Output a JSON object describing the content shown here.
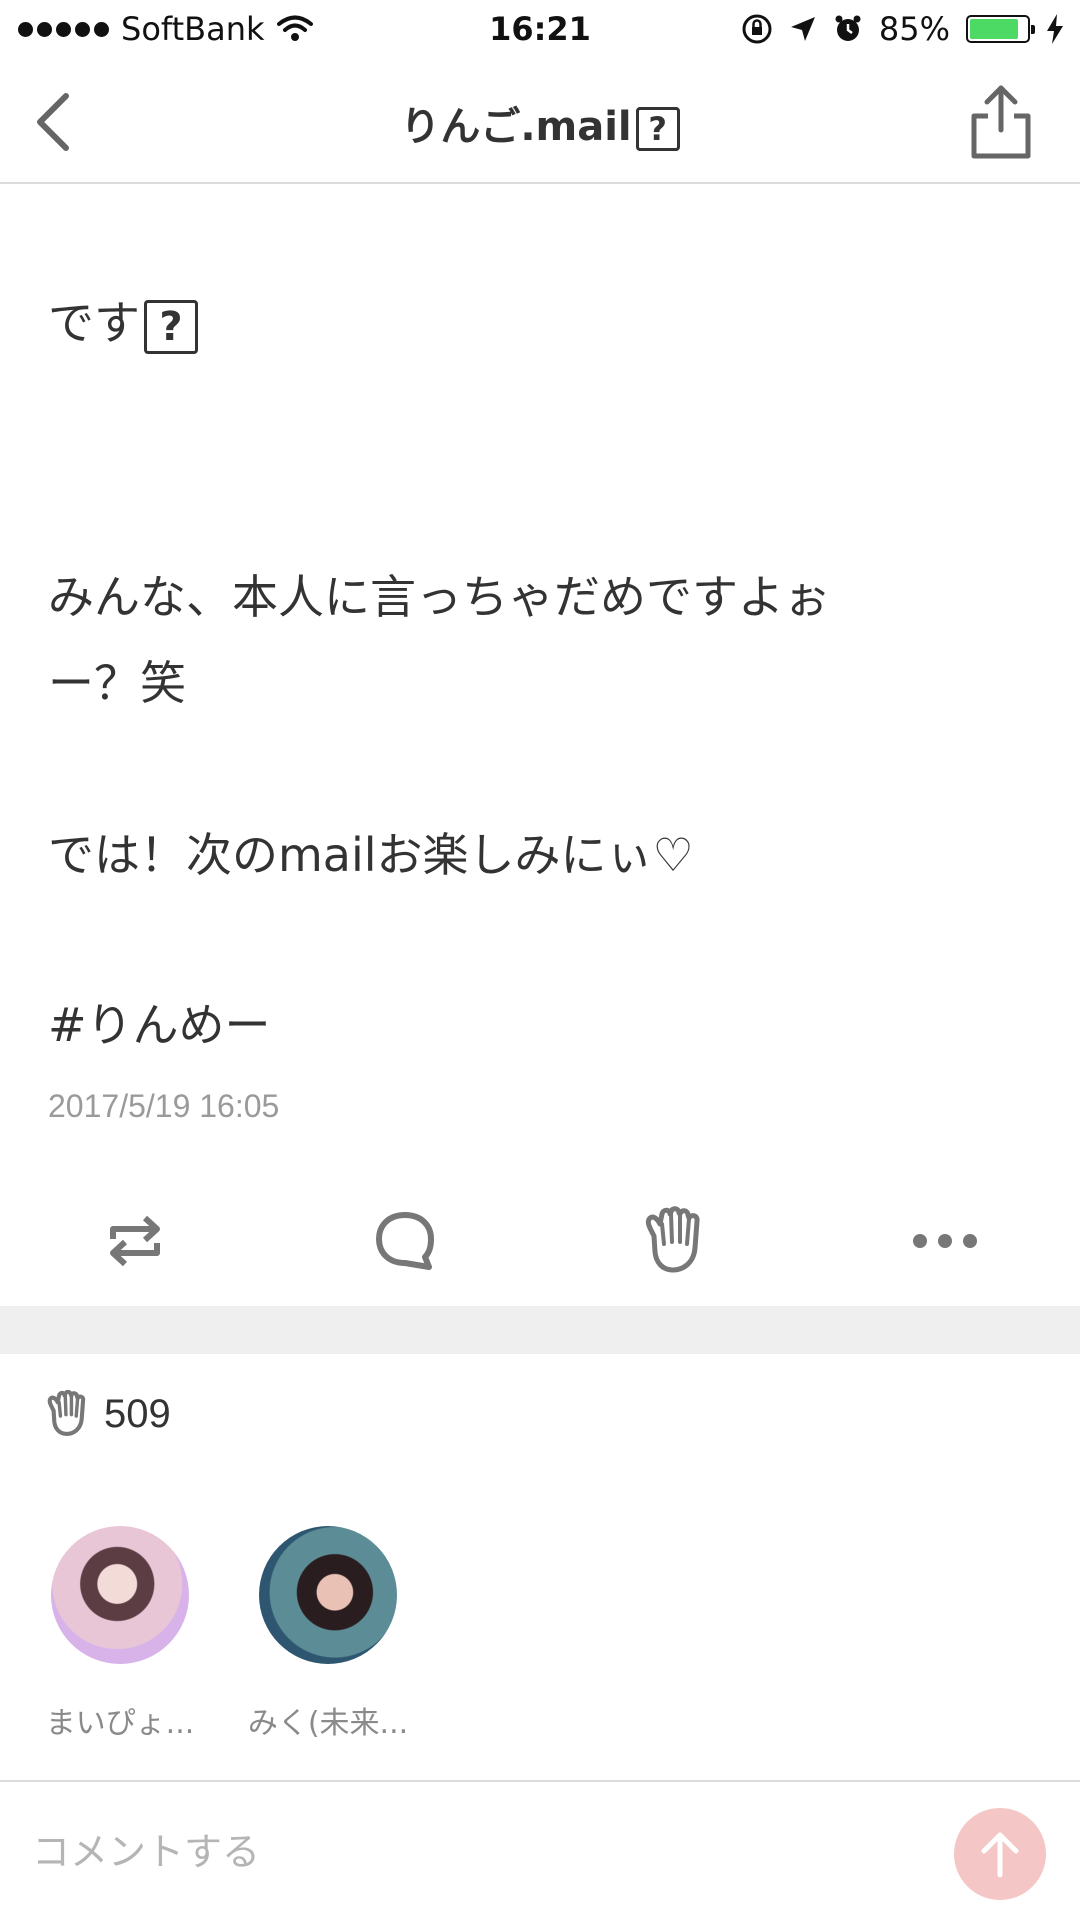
{
  "status_bar": {
    "carrier": "SoftBank",
    "time": "16:21",
    "battery_percent": "85%",
    "battery_level": 0.85
  },
  "nav": {
    "title": "りんご.mail",
    "title_unknown_glyph": "?"
  },
  "post": {
    "line_1": "です",
    "line_1_unknown_glyph": "?",
    "line_2": "みんな、本人に言っちゃだめですよぉ",
    "line_3": "ー？笑",
    "line_4": "では！次のmailお楽しみにぃ♡",
    "hashtag": "#りんめー",
    "timestamp": "2017/5/19 16:05"
  },
  "actions": {
    "repost_icon": "repost-icon",
    "comment_icon": "comment-bubble-icon",
    "clap_icon": "clap-hand-icon",
    "more_icon": "more-dots-icon"
  },
  "claps": {
    "count": "509"
  },
  "clapped_users": [
    {
      "name": "まいぴょ..."
    },
    {
      "name": "みく(未来..."
    }
  ],
  "comment": {
    "placeholder": "コメントする"
  },
  "colors": {
    "accent": "#f5c6c6",
    "icon_gray": "#777777",
    "battery_green": "#4cd964"
  }
}
